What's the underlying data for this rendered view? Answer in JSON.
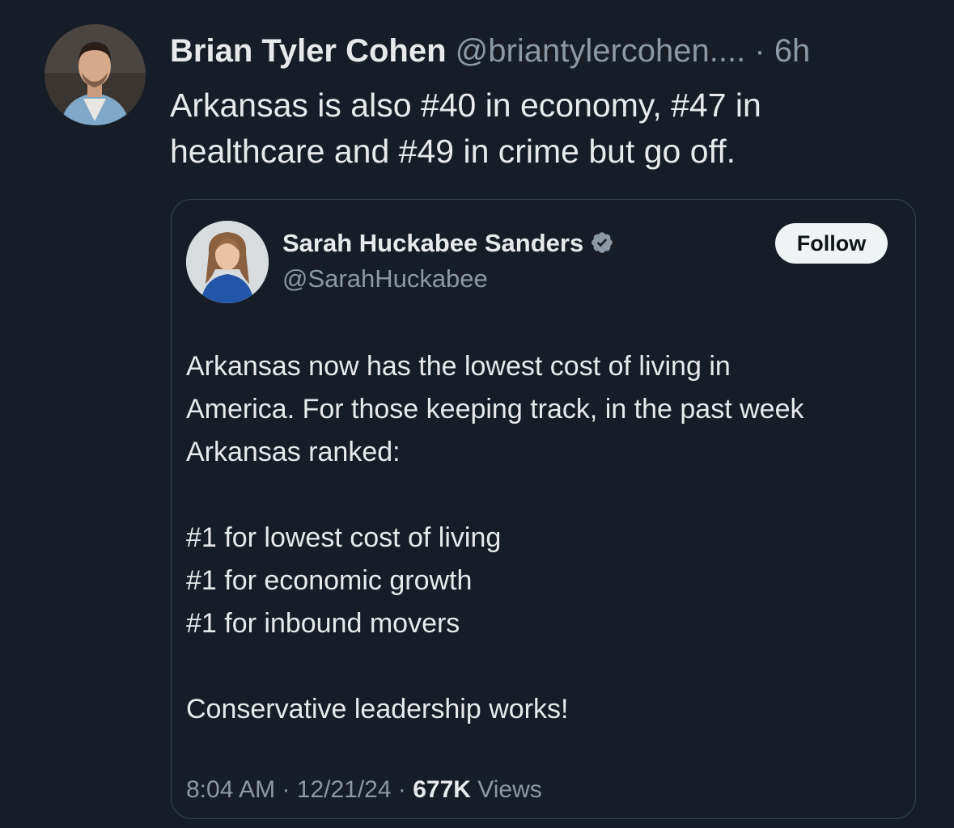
{
  "tweet": {
    "author_name": "Brian Tyler Cohen",
    "author_handle": "@briantylercohen....",
    "separator": "·",
    "time": "6h",
    "text_lines": [
      "Arkansas is also #40 in economy, #47 in",
      "healthcare and #49 in crime but go off."
    ]
  },
  "quoted": {
    "name": "Sarah Huckabee Sanders",
    "handle": "@SarahHuckabee",
    "follow_label": "Follow",
    "verified_icon": "verified-badge-icon",
    "body_lines": [
      "Arkansas now has the lowest cost of living in",
      "America. For those keeping track, in the past week",
      "Arkansas ranked:",
      "",
      "#1 for lowest cost of living",
      "#1 for economic growth",
      "#1 for inbound movers",
      "",
      "Conservative leadership works!"
    ],
    "timestamp": "8:04 AM",
    "date": "12/21/24",
    "meta_separator": "·",
    "views_count": "677K",
    "views_label": "Views"
  },
  "colors": {
    "background": "#171d26",
    "text_primary": "#e7e9ea",
    "text_secondary": "#8b98a5",
    "border": "#3a4450",
    "follow_bg": "#eff3f4",
    "verified": "#8b98a5"
  }
}
